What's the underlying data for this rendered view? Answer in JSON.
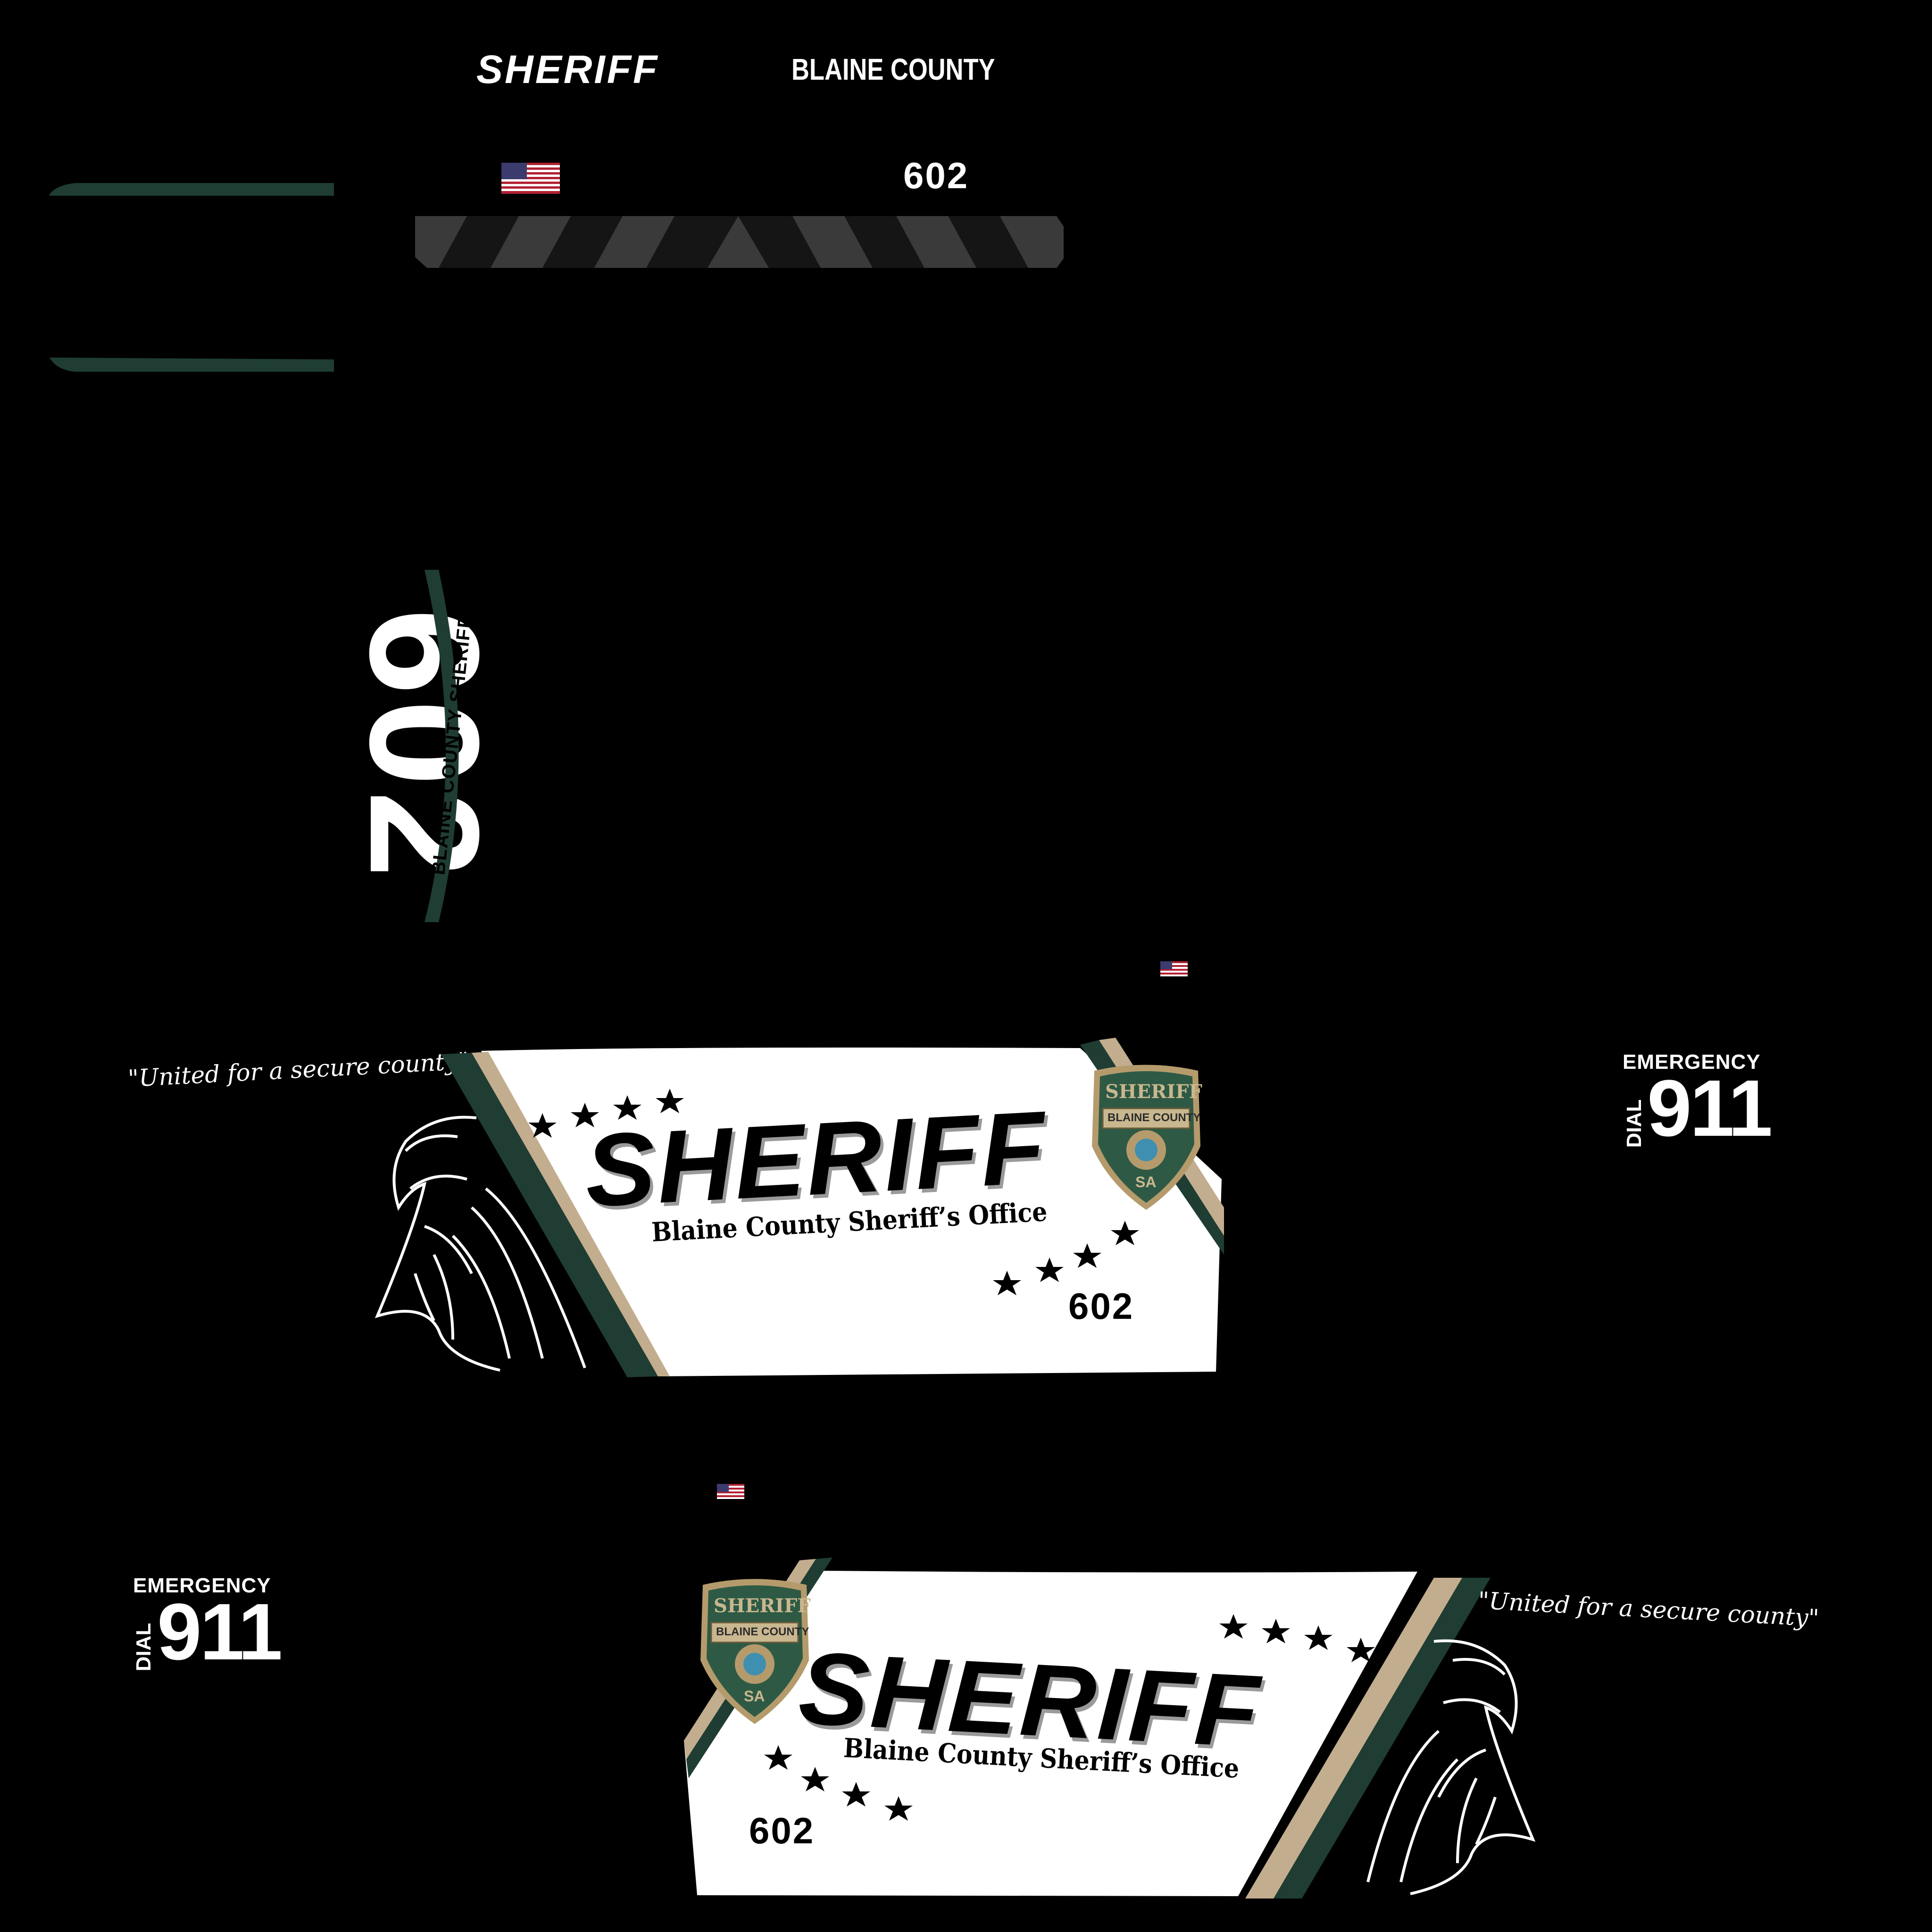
{
  "colors": {
    "background": "#000000",
    "green": "#1f3d33",
    "tan": "#c2ad8e",
    "white": "#ffffff",
    "chevron": "#3a3a3a",
    "badge_green": "#2e5a45",
    "badge_gold": "#b59b6c"
  },
  "top_strip": {
    "sheriff": "SHERIFF",
    "county": "BLAINE COUNTY",
    "unit": "602",
    "flag_icon": "us-flag-icon"
  },
  "roof": {
    "unit": "602",
    "arc_text": "BLAINE COUNTY SHERIFF"
  },
  "side_left": {
    "motto": "\"United for a secure county\"",
    "title": "SHERIFF",
    "subtitle": "Blaine County Sheriff’s Office",
    "unit": "602",
    "emergency": "EMERGENCY",
    "dial": "DIAL",
    "number": "911",
    "badge": {
      "top": "SHERIFF",
      "band": "BLAINE COUNTY",
      "bottom": "SA"
    }
  },
  "side_right": {
    "motto": "\"United for a secure county\"",
    "title": "SHERIFF",
    "subtitle": "Blaine County Sheriff’s Office",
    "unit": "602",
    "emergency": "EMERGENCY",
    "dial": "DIAL",
    "number": "911",
    "badge": {
      "top": "SHERIFF",
      "band": "BLAINE COUNTY",
      "bottom": "SA"
    }
  }
}
